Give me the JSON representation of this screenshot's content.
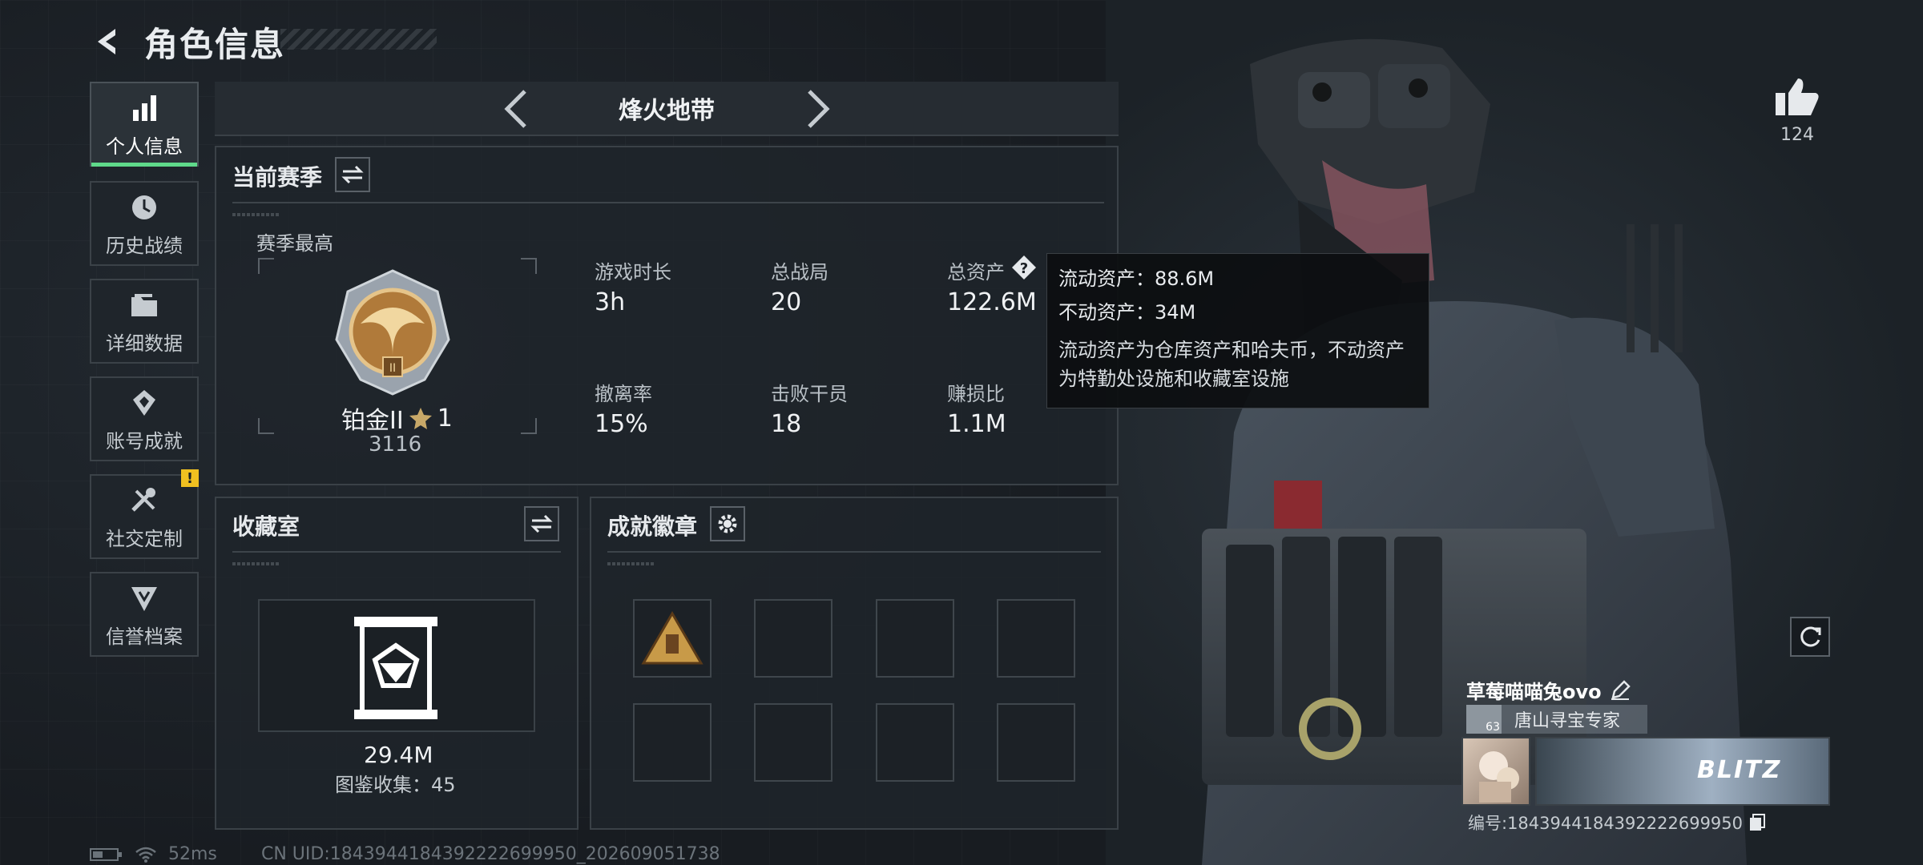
{
  "header": {
    "title": "角色信息"
  },
  "nav": {
    "items": [
      {
        "label": "个人信息",
        "icon": "bar-chart-icon",
        "active": true
      },
      {
        "label": "历史战绩",
        "icon": "history-icon"
      },
      {
        "label": "详细数据",
        "icon": "folder-icon"
      },
      {
        "label": "账号成就",
        "icon": "achievement-icon"
      },
      {
        "label": "社交定制",
        "icon": "tools-icon",
        "badge": "!"
      },
      {
        "label": "信誉档案",
        "icon": "credit-icon"
      }
    ]
  },
  "mode": {
    "title": "烽火地带"
  },
  "season": {
    "title": "当前赛季",
    "best_label": "赛季最高",
    "rank_name": "铂金II",
    "rank_stars": "1",
    "rank_score": "3116",
    "stats": [
      {
        "label": "游戏时长",
        "value": "3h"
      },
      {
        "label": "总战局",
        "value": "20"
      },
      {
        "label": "总资产",
        "value": "122.6M"
      },
      {
        "label": "撤离率",
        "value": "15%"
      },
      {
        "label": "击败干员",
        "value": "18"
      },
      {
        "label": "赚损比",
        "value": "1.1M"
      }
    ]
  },
  "tooltip": {
    "liquid": "流动资产：88.6M",
    "fixed": "不动资产：34M",
    "desc_line1": "流动资产为仓库资产和哈夫币，不动资产",
    "desc_line2": "为特勤处设施和收藏室设施"
  },
  "collection": {
    "title": "收藏室",
    "value": "29.4M",
    "count_text": "图鉴收集：45"
  },
  "achievements": {
    "title": "成就徽章"
  },
  "profile": {
    "likes": "124",
    "name": "草莓喵喵兔ovo",
    "level": "63",
    "tag": "唐山寻宝专家",
    "banner_text": "BLITZ",
    "id_text": "编号:1843944184392222699950"
  },
  "footer": {
    "latency": "52ms",
    "uid": "CN UID:1843944184392222699950_202609051738"
  },
  "colors": {
    "accent_green": "#5fd98a",
    "warning_yellow": "#f0c020"
  }
}
